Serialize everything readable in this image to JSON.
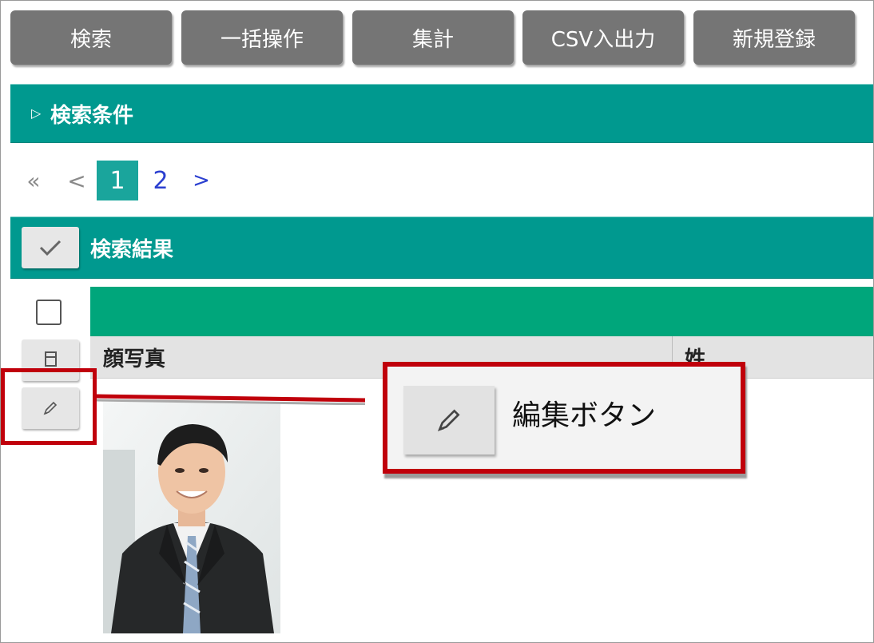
{
  "toolbar": {
    "search_label": "検索",
    "bulk_label": "一括操作",
    "aggregate_label": "集計",
    "csv_label": "CSV入出力",
    "new_label": "新規登録"
  },
  "search_section": {
    "title": "検索条件"
  },
  "pager": {
    "first": "«",
    "prev": "<",
    "current": "1",
    "page2": "2",
    "next": ">"
  },
  "result_section": {
    "title": "検索結果"
  },
  "table": {
    "columns": [
      "顔写真",
      "姓"
    ]
  },
  "callout": {
    "label": "編集ボタン"
  },
  "colors": {
    "teal": "#00998f",
    "green": "#00a67b",
    "highlight": "#c0000b",
    "button": "#757575"
  },
  "icons": {
    "check": "check-icon",
    "detail": "document-icon",
    "edit": "pencil-icon",
    "expand": "triangle-right-icon"
  }
}
